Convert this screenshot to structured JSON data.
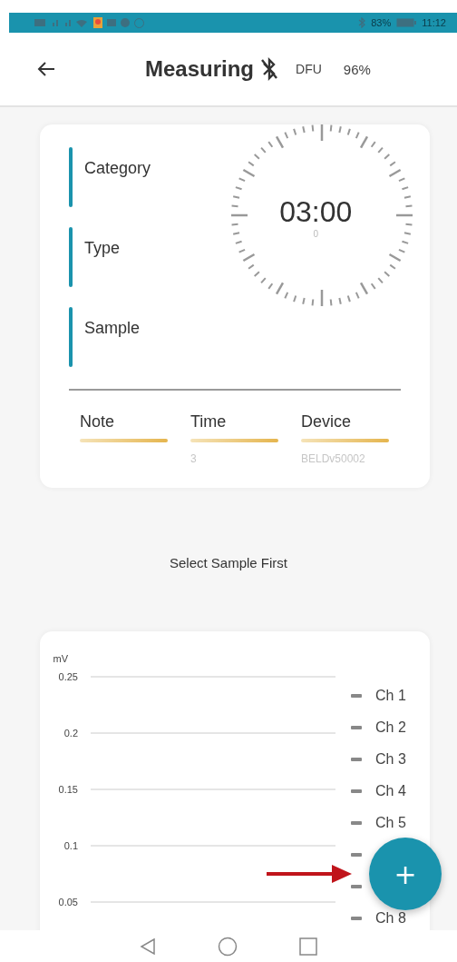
{
  "status_bar": {
    "battery": "83%",
    "time": "11:12"
  },
  "header": {
    "title": "Measuring",
    "dfu": "DFU",
    "level_text": "96%"
  },
  "info": [
    {
      "label": "Category"
    },
    {
      "label": "Type"
    },
    {
      "label": "Sample"
    }
  ],
  "timer": {
    "time": "03:00",
    "count": "0"
  },
  "fields": [
    {
      "label": "Note"
    },
    {
      "label": "Time",
      "value": "3"
    },
    {
      "label": "Device",
      "value": "BELDv50002"
    }
  ],
  "message": "Select Sample First",
  "chart": {
    "unit": "mV",
    "ticks": [
      "0.25",
      "0.2",
      "0.15",
      "0.1",
      "0.05"
    ],
    "legend": [
      {
        "kind": "entry",
        "label": "Ch 1"
      },
      {
        "kind": "entry",
        "label": "Ch 2"
      },
      {
        "kind": "entry",
        "label": "Ch 3"
      },
      {
        "kind": "entry",
        "label": "Ch 4"
      },
      {
        "kind": "entry",
        "label": "Ch 5"
      },
      {
        "kind": "swatch"
      },
      {
        "kind": "swatch"
      },
      {
        "kind": "entry",
        "label": "Ch 8"
      }
    ]
  },
  "fab": {
    "symbol": "+"
  }
}
